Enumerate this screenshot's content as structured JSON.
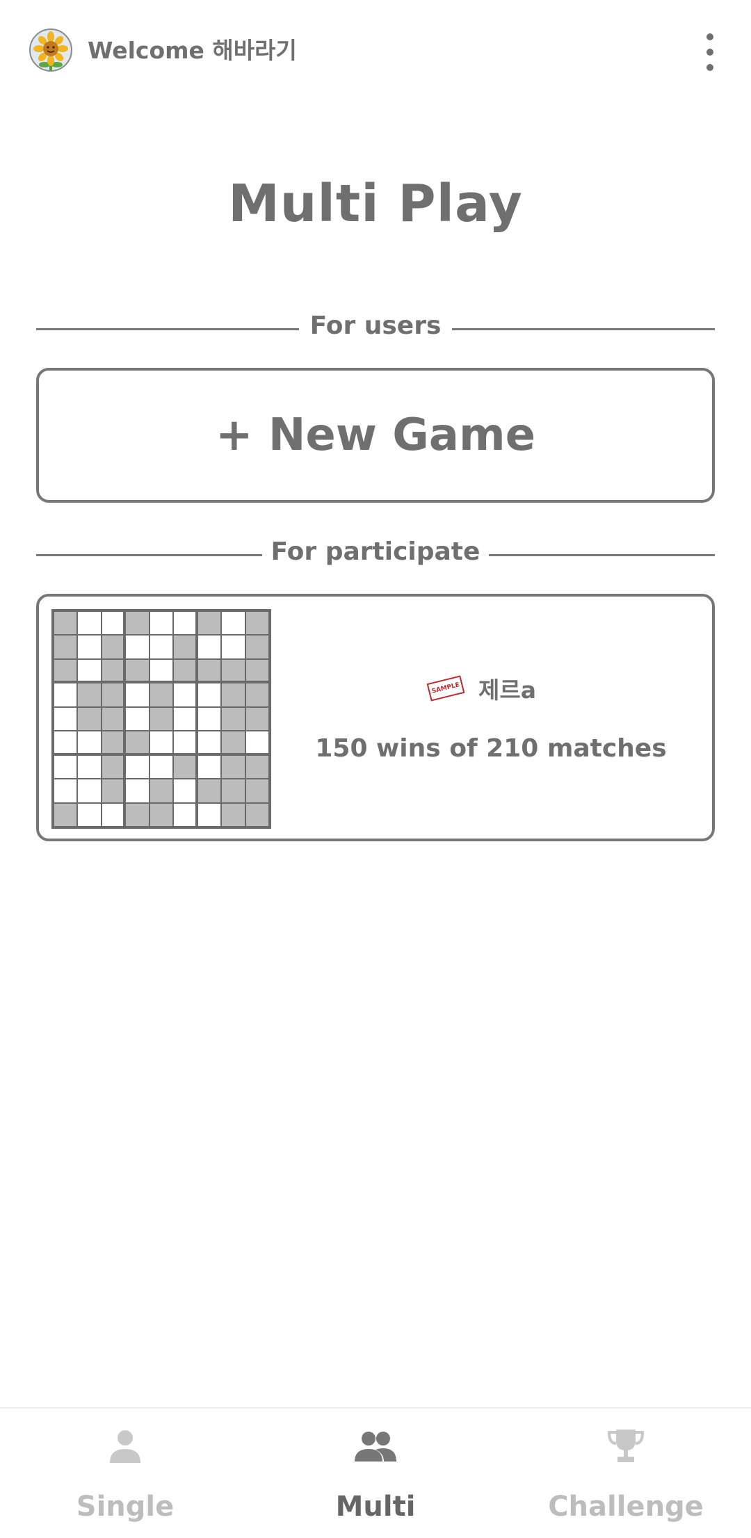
{
  "header": {
    "welcome_text": "Welcome 해바라기",
    "avatar_icon": "sunflower-avatar",
    "menu_icon": "more-vertical-icon"
  },
  "page": {
    "title": "Multi Play"
  },
  "sections": {
    "for_users_label": "For users",
    "for_participate_label": "For participate"
  },
  "new_game": {
    "label": "+ New Game"
  },
  "game_card": {
    "stamp_text": "SAMPLE",
    "player_name": "제르a",
    "record": "150 wins of 210 matches",
    "board_icon": "sudoku-board-thumbnail",
    "board_pattern": [
      "F..F..F.F",
      "F.F..F..F",
      "F.FF.FFFF",
      ".FF.F..FF",
      ".FF.F..FF",
      "..FF...F.",
      "..F..F.FF",
      "..F.F.FFF",
      "F..FF..FF"
    ]
  },
  "bottom_nav": {
    "tabs": [
      {
        "label": "Single",
        "icon": "person-icon",
        "active": false
      },
      {
        "label": "Multi",
        "icon": "group-icon",
        "active": true
      },
      {
        "label": "Challenge",
        "icon": "trophy-icon",
        "active": false
      }
    ]
  },
  "colors": {
    "text": "#6f6f6f",
    "inactive": "#bdbdbd",
    "filled_cell": "#bcbcbc",
    "stamp_red": "#c0282c"
  }
}
